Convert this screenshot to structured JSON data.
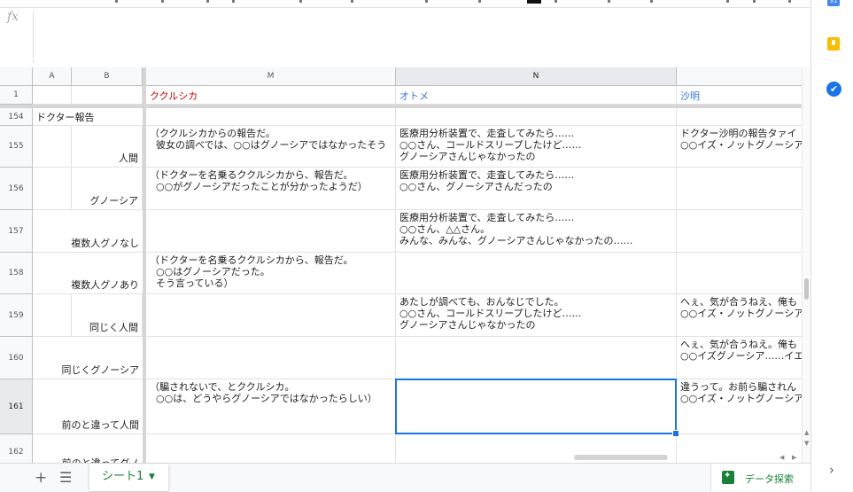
{
  "formula_bar": {
    "fx_label": "fx",
    "content": ""
  },
  "columns": [
    {
      "id": "A",
      "label": "A"
    },
    {
      "id": "B",
      "label": "B"
    },
    {
      "id": "M",
      "label": "M"
    },
    {
      "id": "N",
      "label": "N"
    },
    {
      "id": "O",
      "label": ""
    }
  ],
  "selected_column": "N",
  "header_row": {
    "row_label": "1",
    "M": "ククルシカ",
    "N": "オトメ",
    "O": "沙明"
  },
  "header_colors": {
    "M": "#cc0000",
    "N": "#3c78d8",
    "O": "#3c78d8"
  },
  "rows": [
    {
      "row_label": "154",
      "A": "ドクター報告",
      "B": "",
      "M": "",
      "N": "",
      "O": ""
    },
    {
      "row_label": "155",
      "A": "",
      "B": "人間",
      "M": "（ククルシカからの報告だ。\n  彼女の調べでは、○○はグノーシアではなかったそう",
      "N": "医療用分析装置で、走査してみたら……\n○○さん、コールドスリープしたけど……\nグノーシアさんじゃなかったの",
      "O": "ドクター沙明の報告タァイ\n○○イズ・ノットグノーシア"
    },
    {
      "row_label": "156",
      "A": "",
      "B": "グノーシア",
      "M": "（ドクターを名乗るククルシカから、報告だ。\n  ○○がグノーシアだったことが分かったようだ）",
      "N": "医療用分析装置で、走査してみたら……\n○○さん、グノーシアさんだったの",
      "O": ""
    },
    {
      "row_label": "157",
      "A": "",
      "B": "複数人グノなし",
      "M": "",
      "N": "医療用分析装置で、走査してみたら……\n○○さん、△△さん。\nみんな、みんな、グノーシアさんじゃなかったの……",
      "O": ""
    },
    {
      "row_label": "158",
      "A": "",
      "B": "複数人グノあり",
      "M": "（ドクターを名乗るククルシカから、報告だ。\n  ○○はグノーシアだった。\n  そう言っている）",
      "N": "",
      "O": ""
    },
    {
      "row_label": "159",
      "A": "",
      "B": "同じく人間",
      "M": "",
      "N": "あたしが調べても、おんなじでした。\n○○さん、コールドスリープしたけど……\nグノーシアさんじゃなかったの",
      "O": "へぇ、気が合うねえ、俺も\n○○イズ・ノットグノーシア"
    },
    {
      "row_label": "160",
      "A": "",
      "B": "同じくグノーシア",
      "M": "",
      "N": "",
      "O": "へぇ、気が合うねえ。俺も\n○○イズグノーシア……イエ"
    },
    {
      "row_label": "161",
      "A": "",
      "B": "前のと違って人間",
      "M": "（騙されないで、とククルシカ。\n  ○○は、どうやらグノーシアではなかったらしい）",
      "N": "",
      "O": "違うって。お前ら騙されん\n○○イズ・ノットグノーシア"
    },
    {
      "row_label": "162",
      "A": "",
      "B": "前のと違ってグノ",
      "M": "",
      "N": "",
      "O": ""
    }
  ],
  "selected_row": "161",
  "selected_cell": "N161",
  "sheet_tabs": [
    {
      "label": "シート1",
      "active": true
    }
  ],
  "bottom_bar": {
    "add_sheet_icon": "plus-icon",
    "all_sheets_icon": "list-icon",
    "explore_label": "データ探索"
  },
  "side_panel": {
    "icons": [
      "calendar-icon",
      "keep-icon",
      "tasks-icon"
    ],
    "calendar_text": "31",
    "expand_icon": "chevron-right-icon"
  },
  "colors": {
    "accent": "#1a73e8",
    "sheet_green": "#188038"
  }
}
